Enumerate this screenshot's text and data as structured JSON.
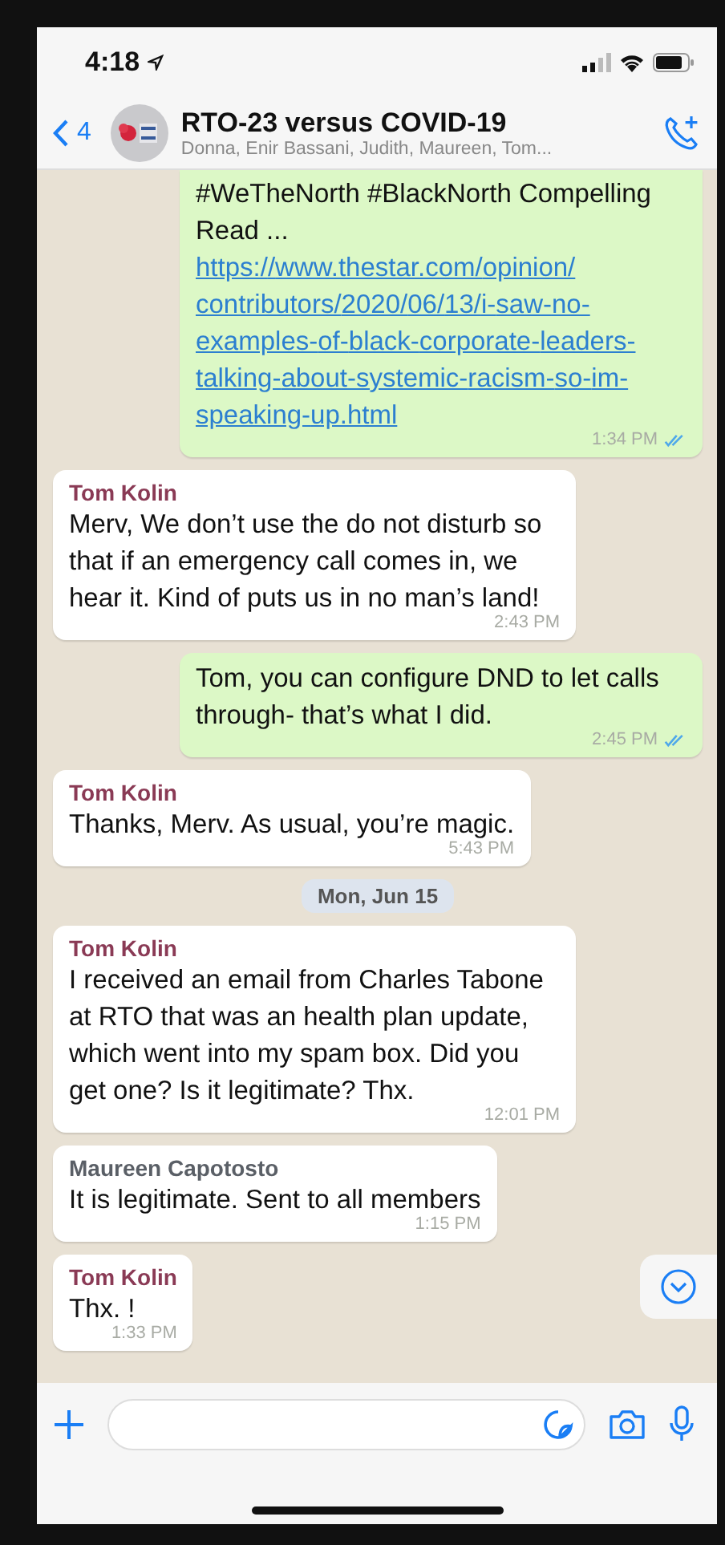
{
  "status_bar": {
    "time": "4:18"
  },
  "header": {
    "back_count": "4",
    "title": "RTO-23 versus COVID-19",
    "subtitle": "Donna, Enir Bassani, Judith, Maureen, Tom..."
  },
  "messages": [
    {
      "kind": "outgoing",
      "text": "#WeTheNorth #BlackNorth Compelling Read ...",
      "link": "https://www.thestar.com/opinion/contributors/2020/06/13/i-saw-no-examples-of-black-corporate-leaders-talking-about-systemic-racism-so-im-speaking-up.html",
      "time": "1:34 PM",
      "read": true
    },
    {
      "kind": "incoming",
      "sender": "Tom Kolin",
      "color": "#8a3a55",
      "text": "Merv, We don’t use the do not disturb so that if an emergency call comes in, we hear it. Kind of puts us in no man’s land!",
      "time": "2:43 PM"
    },
    {
      "kind": "outgoing",
      "text": "Tom, you can configure DND to let calls through- that’s what I did.",
      "time": "2:45 PM",
      "read": true
    },
    {
      "kind": "incoming",
      "sender": "Tom Kolin",
      "color": "#8a3a55",
      "text": "Thanks, Merv. As usual, you’re magic.",
      "time": "5:43 PM"
    },
    {
      "kind": "date",
      "text": "Mon, Jun 15"
    },
    {
      "kind": "incoming",
      "sender": "Tom Kolin",
      "color": "#8a3a55",
      "text": "I received an email from Charles Tabone at RTO that was an health plan update, which went into my spam box. Did you get one? Is it legitimate?  Thx.",
      "time": "12:01 PM"
    },
    {
      "kind": "incoming",
      "sender": "Maureen Capotosto",
      "color": "#5a5f66",
      "text": "It is legitimate. Sent to all members",
      "time": "1:15 PM"
    },
    {
      "kind": "incoming",
      "sender": "Tom Kolin",
      "color": "#8a3a55",
      "text": "Thx. !",
      "time": "1:33 PM"
    }
  ]
}
